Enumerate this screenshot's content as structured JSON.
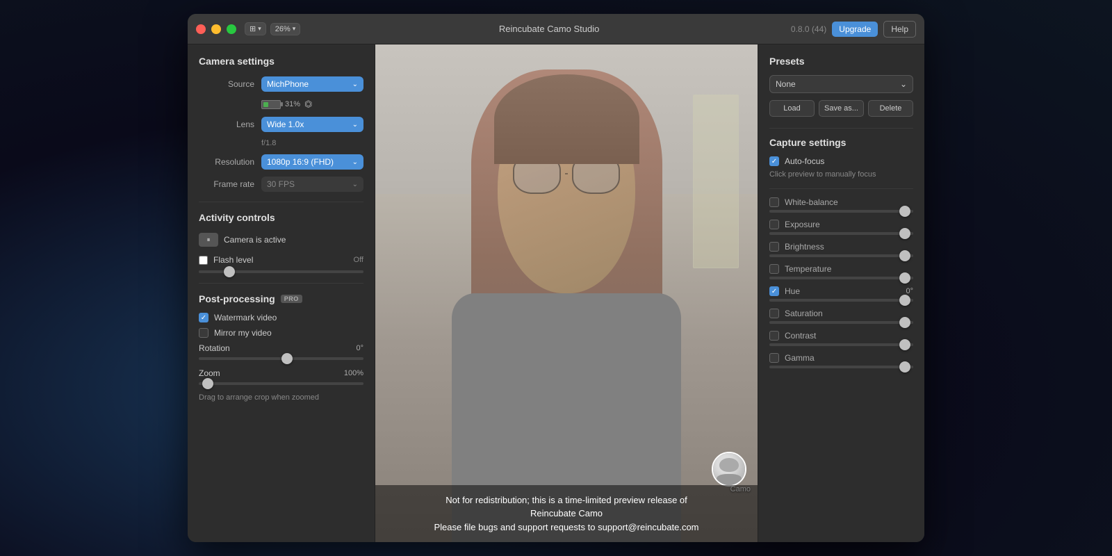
{
  "app": {
    "title": "Reincubate Camo Studio",
    "version": "0.8.0 (44)",
    "zoom_label": "26%"
  },
  "titlebar": {
    "upgrade_label": "Upgrade",
    "help_label": "Help"
  },
  "left": {
    "camera_settings_title": "Camera settings",
    "source_label": "Source",
    "source_value": "MichPhone",
    "battery_pct": "31%",
    "lens_label": "Lens",
    "lens_value": "Wide 1.0x",
    "f_number": "f/1.8",
    "resolution_label": "Resolution",
    "resolution_value": "1080p 16:9 (FHD)",
    "frame_rate_label": "Frame rate",
    "frame_rate_value": "30 FPS",
    "activity_title": "Activity controls",
    "camera_active": "Camera is active",
    "flash_level": "Flash level",
    "flash_off": "Off",
    "post_processing_title": "Post-processing",
    "pro_badge": "PRO",
    "watermark_label": "Watermark video",
    "mirror_label": "Mirror my video",
    "rotation_label": "Rotation",
    "rotation_val": "0°",
    "zoom_label": "Zoom",
    "zoom_val": "100%",
    "drag_hint": "Drag to arrange crop when zoomed"
  },
  "preview": {
    "watermark_line1": "Not for redistribution; this is a time-limited preview release of",
    "watermark_line2": "Reincubate Camo",
    "watermark_line3": "Please file bugs and support requests to support@reincubate.com",
    "camo_label": "Camo"
  },
  "right": {
    "presets_title": "Presets",
    "presets_none": "None",
    "load_label": "Load",
    "save_as_label": "Save as...",
    "delete_label": "Delete",
    "capture_title": "Capture settings",
    "autofocus_label": "Auto-focus",
    "autofocus_hint": "Click preview to manually focus",
    "white_balance_label": "White-balance",
    "exposure_label": "Exposure",
    "brightness_label": "Brightness",
    "temperature_label": "Temperature",
    "hue_label": "Hue",
    "hue_val": "0°",
    "saturation_label": "Saturation",
    "contrast_label": "Contrast",
    "gamma_label": "Gamma"
  }
}
